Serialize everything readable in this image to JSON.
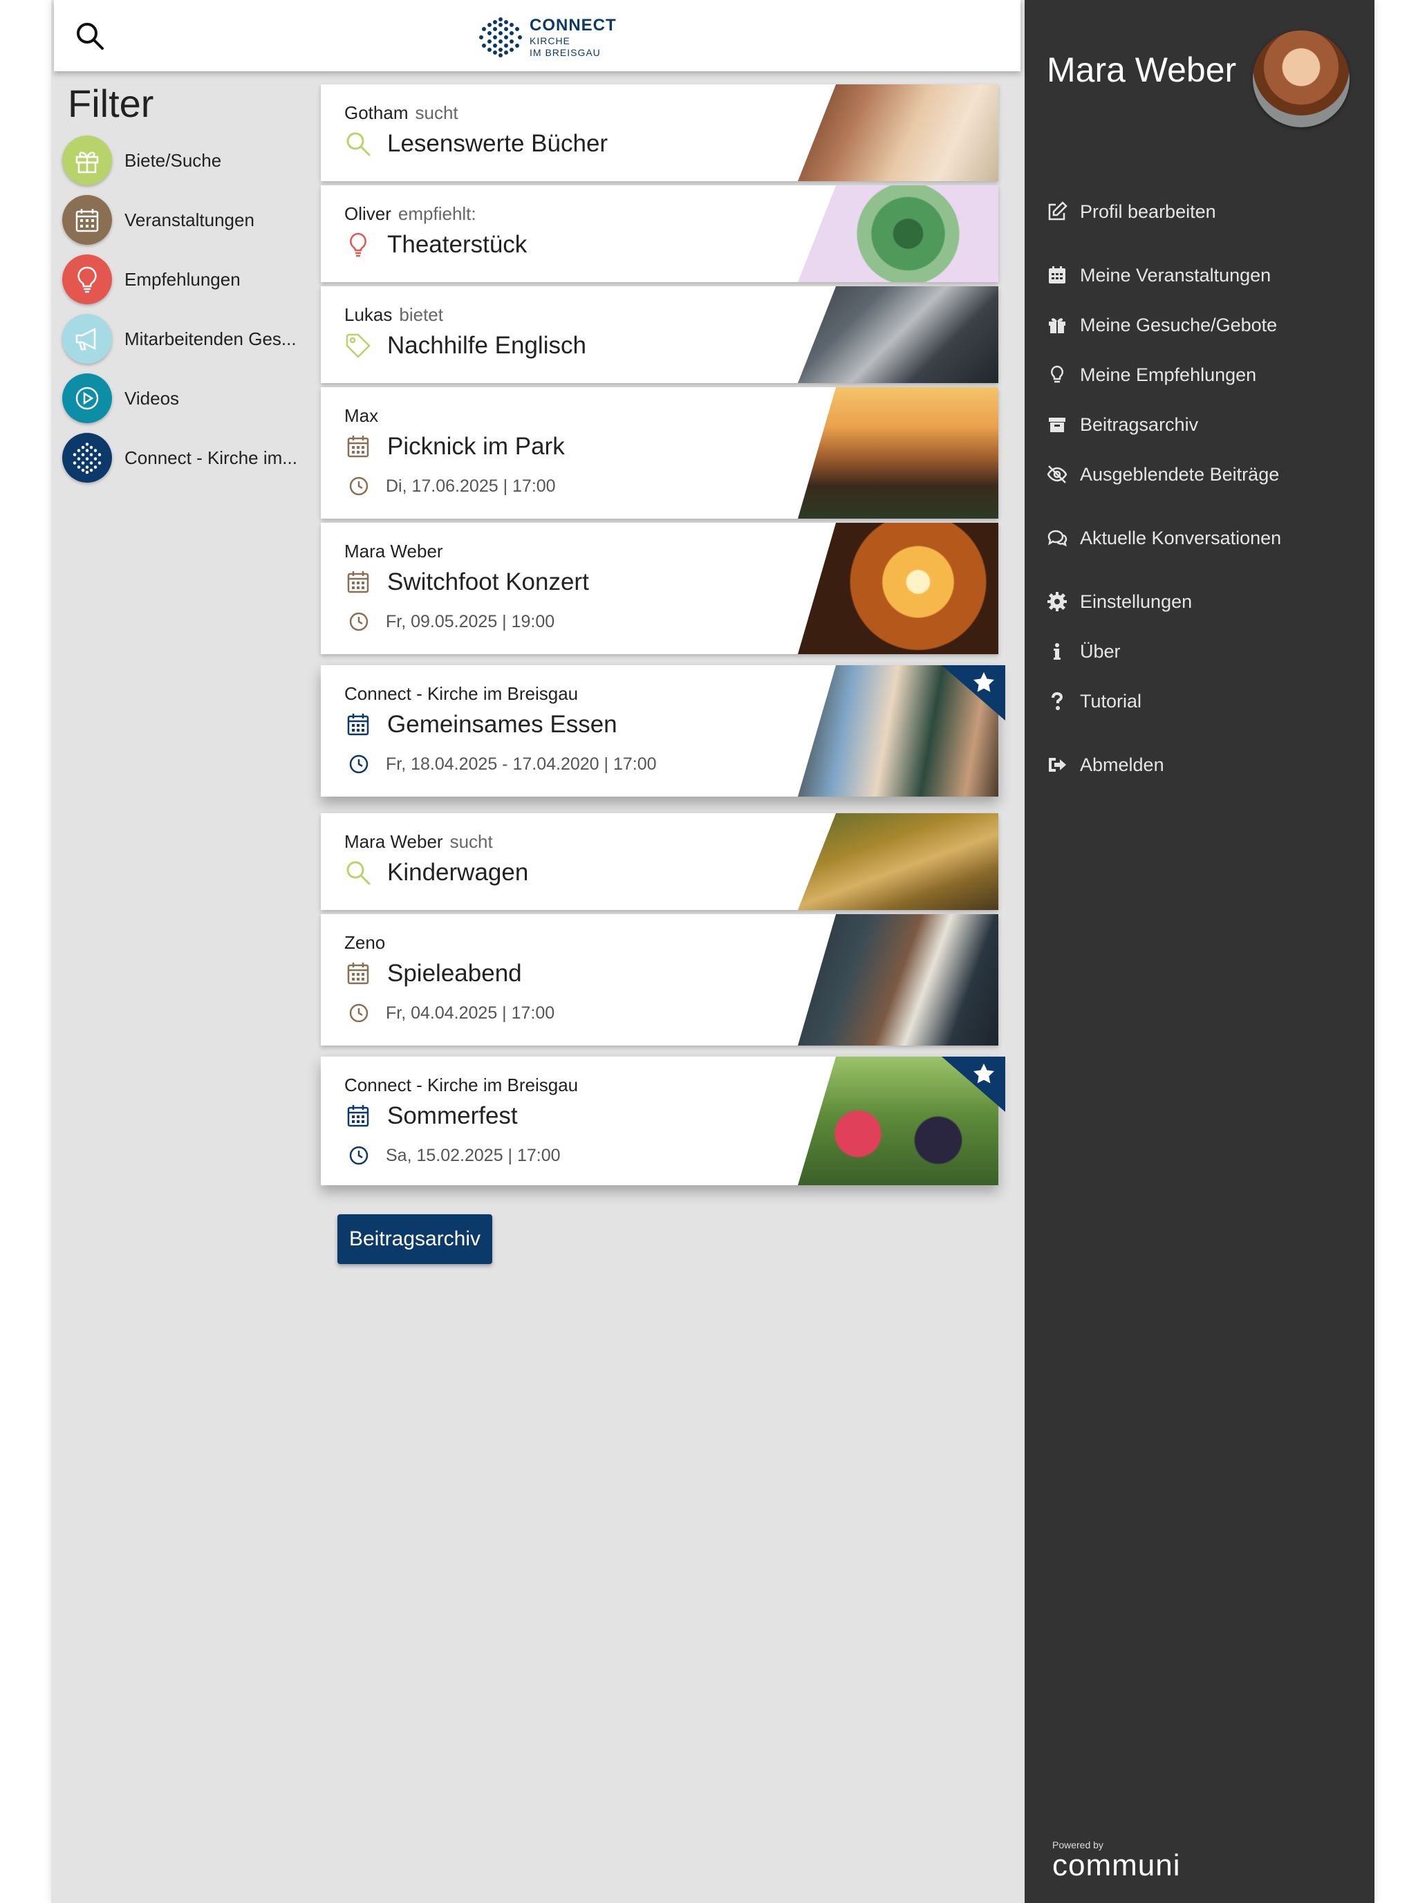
{
  "header": {
    "logo": {
      "line1": "CONNECT",
      "line2": "KIRCHE",
      "line3": "IM BREISGAU"
    }
  },
  "filter": {
    "title": "Filter",
    "items": [
      {
        "label": "Biete/Suche",
        "color": "#b7d36a",
        "icon": "gift-icon"
      },
      {
        "label": "Veranstaltungen",
        "color": "#8a6f52",
        "icon": "calendar-icon"
      },
      {
        "label": "Empfehlungen",
        "color": "#e4574e",
        "icon": "lightbulb-icon"
      },
      {
        "label": "Mitarbeitenden Ges...",
        "color": "#a6dbe6",
        "icon": "megaphone-icon"
      },
      {
        "label": "Videos",
        "color": "#0c8ea6",
        "icon": "play-icon"
      },
      {
        "label": "Connect - Kirche im...",
        "color": "#0b3a6a",
        "icon": "connect-logo-icon"
      }
    ]
  },
  "feed": [
    {
      "author": "Gotham",
      "verb": "sucht",
      "title": "Lesenswerte Bücher",
      "type": "search",
      "icon": "search-icon",
      "accent": "#b7d36a"
    },
    {
      "author": "Oliver",
      "verb": "empfiehlt:",
      "title": "Theaterstück",
      "type": "recommendation",
      "icon": "lightbulb-icon",
      "accent": "#e4574e"
    },
    {
      "author": "Lukas",
      "verb": "bietet",
      "title": "Nachhilfe Englisch",
      "type": "offer",
      "icon": "tag-icon",
      "accent": "#b7d36a"
    },
    {
      "author": "Max",
      "verb": "",
      "title": "Picknick im Park",
      "date": "Di, 17.06.2025 | 17:00",
      "type": "event",
      "icon": "calendar-icon",
      "accent": "#8a6f52"
    },
    {
      "author": "Mara Weber",
      "verb": "",
      "title": "Switchfoot Konzert",
      "date": "Fr, 09.05.2025 | 19:00",
      "type": "event",
      "icon": "calendar-icon",
      "accent": "#8a6f52"
    },
    {
      "author": "Connect - Kirche im Breisgau",
      "verb": "",
      "title": "Gemeinsames Essen",
      "date": "Fr, 18.04.2025 - 17.04.2020 | 17:00",
      "type": "event",
      "icon": "calendar-icon",
      "accent": "#0b3a6a",
      "featured": true
    },
    {
      "author": "Mara Weber",
      "verb": "sucht",
      "title": "Kinderwagen",
      "type": "search",
      "icon": "search-icon",
      "accent": "#b7d36a"
    },
    {
      "author": "Zeno",
      "verb": "",
      "title": "Spieleabend",
      "date": "Fr, 04.04.2025 | 17:00",
      "type": "event",
      "icon": "calendar-icon",
      "accent": "#8a6f52"
    },
    {
      "author": "Connect - Kirche im Breisgau",
      "verb": "",
      "title": "Sommerfest",
      "date": "Sa, 15.02.2025 | 17:00",
      "type": "event",
      "icon": "calendar-icon",
      "accent": "#0b3a6a",
      "featured": true
    }
  ],
  "archive_button": "Beitragsarchiv",
  "panel": {
    "user_name": "Mara Weber",
    "menu": [
      {
        "label": "Profil bearbeiten",
        "icon": "edit-icon"
      },
      {
        "label": "Meine Veranstaltungen",
        "icon": "calendar-icon"
      },
      {
        "label": "Meine Gesuche/Gebote",
        "icon": "gift-icon"
      },
      {
        "label": "Meine Empfehlungen",
        "icon": "lightbulb-icon"
      },
      {
        "label": "Beitragsarchiv",
        "icon": "archive-icon"
      },
      {
        "label": "Ausgeblendete Beiträge",
        "icon": "eye-slash-icon"
      },
      {
        "label": "Aktuelle Konversationen",
        "icon": "chat-icon"
      },
      {
        "label": "Einstellungen",
        "icon": "gear-icon"
      },
      {
        "label": "Über",
        "icon": "info-icon"
      },
      {
        "label": "Tutorial",
        "icon": "question-icon"
      },
      {
        "label": "Abmelden",
        "icon": "logout-icon"
      }
    ],
    "powered_by": "Powered by",
    "brand": "communi"
  },
  "colors": {
    "primary": "#0b3a6a",
    "panel_bg": "#333333",
    "page_bg": "#e3e3e3"
  }
}
